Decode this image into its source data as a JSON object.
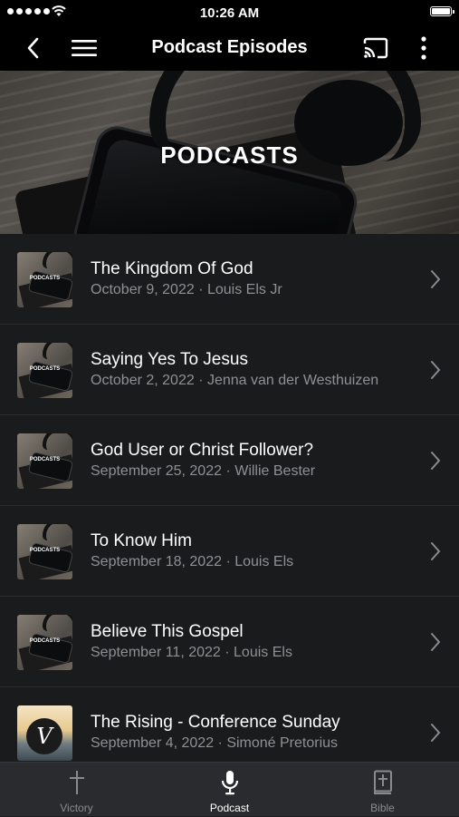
{
  "status_bar": {
    "time": "10:26 AM"
  },
  "nav": {
    "title": "Podcast Episodes",
    "back_icon": "chevron-left-icon",
    "menu_icon": "hamburger-icon",
    "cast_icon": "cast-icon",
    "more_icon": "more-vertical-icon"
  },
  "hero": {
    "label": "PODCASTS"
  },
  "episodes": [
    {
      "title": "The Kingdom Of God",
      "meta": "October 9, 2022 · Louis Els Jr",
      "thumb": "PODCASTS"
    },
    {
      "title": "Saying Yes To Jesus",
      "meta": "October 2, 2022 · Jenna van der Westhuizen",
      "thumb": "PODCASTS"
    },
    {
      "title": "God User or Christ Follower?",
      "meta": "September 25, 2022 · Willie Bester",
      "thumb": "PODCASTS"
    },
    {
      "title": "To Know Him",
      "meta": "September 18, 2022 · Louis Els",
      "thumb": "PODCASTS"
    },
    {
      "title": "Believe This Gospel",
      "meta": "September 11, 2022 · Louis Els",
      "thumb": "PODCASTS"
    },
    {
      "title": "The Rising - Conference Sunday",
      "meta": "September 4, 2022 · Simoné Pretorius",
      "thumb": "V"
    }
  ],
  "tabs": [
    {
      "label": "Victory",
      "icon": "cross-icon",
      "active": false
    },
    {
      "label": "Podcast",
      "icon": "microphone-icon",
      "active": true
    },
    {
      "label": "Bible",
      "icon": "bible-icon",
      "active": false
    }
  ],
  "colors": {
    "background": "#1a1b1d",
    "bar": "#000000",
    "tabbar": "#2a2b2e",
    "meta_text": "#8f9094"
  }
}
